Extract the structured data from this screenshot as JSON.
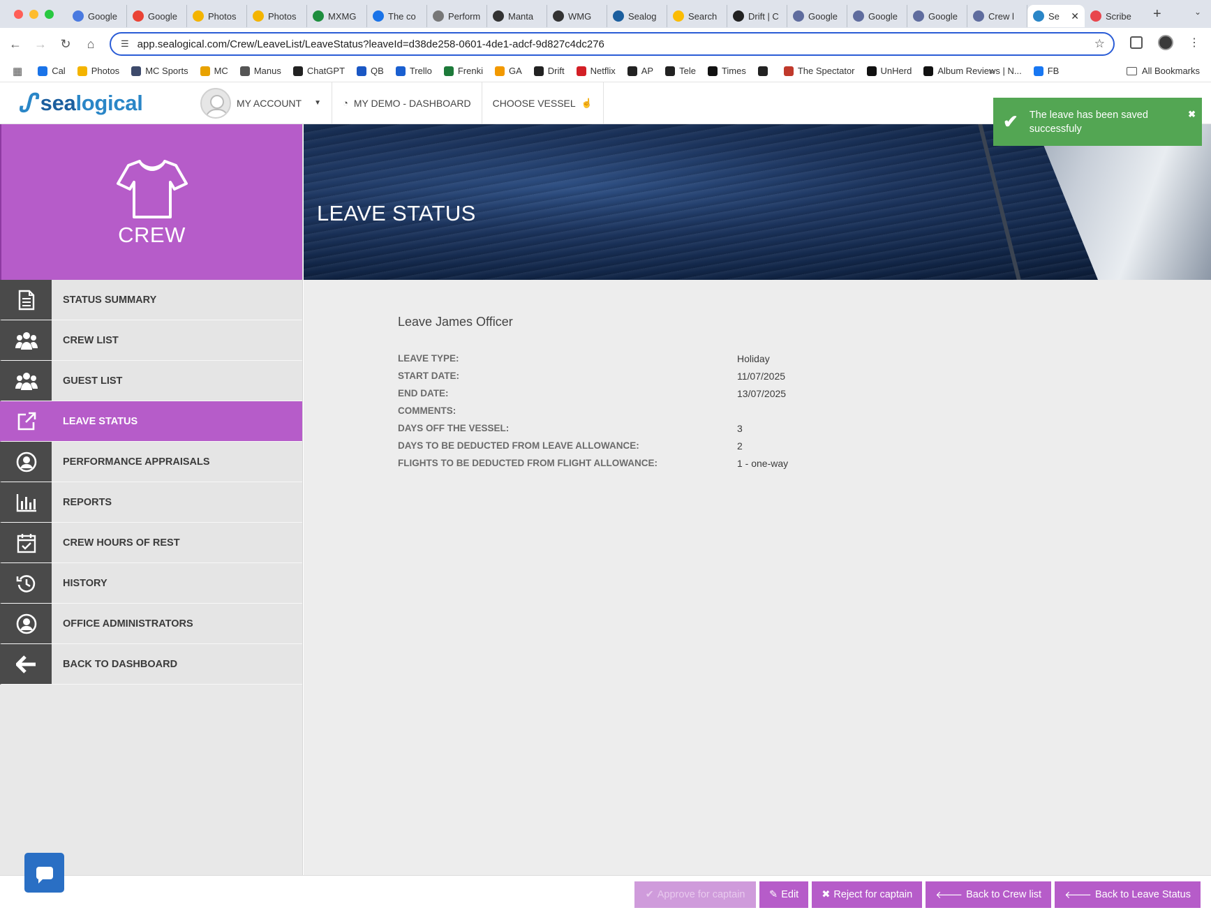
{
  "browser": {
    "tabs": [
      {
        "label": "Google",
        "color": "#4a7ae0"
      },
      {
        "label": "Google",
        "color": "#ea4335"
      },
      {
        "label": "Photos",
        "color": "#f4b400"
      },
      {
        "label": "Photos",
        "color": "#f4b400"
      },
      {
        "label": "MXMG",
        "color": "#1e8e3e"
      },
      {
        "label": "The co",
        "color": "#1a73e8"
      },
      {
        "label": "Perform",
        "color": "#777777"
      },
      {
        "label": "Manta",
        "color": "#333333"
      },
      {
        "label": "WMG",
        "color": "#333333"
      },
      {
        "label": "Sealog",
        "color": "#1b5e9e"
      },
      {
        "label": "Search",
        "color": "#fbbc04"
      },
      {
        "label": "Drift | C",
        "color": "#222222"
      },
      {
        "label": "Google",
        "color": "#5f6c9e"
      },
      {
        "label": "Google",
        "color": "#5f6c9e"
      },
      {
        "label": "Google",
        "color": "#5f6c9e"
      },
      {
        "label": "Crew l",
        "color": "#5f6c9e"
      }
    ],
    "active_tab": {
      "label": "Se",
      "color": "#2a86c7"
    },
    "after_tab": {
      "label": "Scribe",
      "color": "#e8464d"
    },
    "url": "app.sealogical.com/Crew/LeaveList/LeaveStatus?leaveId=d38de258-0601-4de1-adcf-9d827c4dc276",
    "bookmarks": [
      {
        "label": "Cal",
        "color": "#1a73e8"
      },
      {
        "label": "Photos",
        "color": "#f4b400"
      },
      {
        "label": "MC Sports",
        "color": "#3d4a6b"
      },
      {
        "label": "MC",
        "color": "#e8a200"
      },
      {
        "label": "Manus",
        "color": "#555555"
      },
      {
        "label": "ChatGPT",
        "color": "#222222"
      },
      {
        "label": "QB",
        "color": "#1a57c4"
      },
      {
        "label": "Trello",
        "color": "#1a5fd0"
      },
      {
        "label": "Frenki",
        "color": "#1d7a3a"
      },
      {
        "label": "GA",
        "color": "#f29900"
      },
      {
        "label": "Drift",
        "color": "#222222"
      },
      {
        "label": "Netflix",
        "color": "#d31f26"
      },
      {
        "label": "AP",
        "color": "#222222"
      },
      {
        "label": "Tele",
        "color": "#222222"
      },
      {
        "label": "Times",
        "color": "#111111"
      },
      {
        "label": "",
        "color": "#222222"
      },
      {
        "label": "The Spectator",
        "color": "#c0392b"
      },
      {
        "label": "UnHerd",
        "color": "#111111"
      },
      {
        "label": "Album Reviews | N...",
        "color": "#111111"
      },
      {
        "label": "FB",
        "color": "#1877f2"
      }
    ],
    "all_bookmarks": "All Bookmarks"
  },
  "header": {
    "logo": {
      "part1": "sea",
      "part2": "logical"
    },
    "account_label": "MY ACCOUNT",
    "dashboard_label": "MY DEMO - DASHBOARD",
    "vessel_label": "CHOOSE VESSEL"
  },
  "toast": {
    "message": "The leave has been saved successfuly",
    "close": "✖"
  },
  "sidebar": {
    "section_title": "CREW",
    "items": [
      {
        "label": "STATUS SUMMARY",
        "icon": "document-icon"
      },
      {
        "label": "CREW LIST",
        "icon": "users-icon"
      },
      {
        "label": "GUEST LIST",
        "icon": "users-icon"
      },
      {
        "label": "LEAVE STATUS",
        "icon": "external-link-icon",
        "active": true
      },
      {
        "label": "PERFORMANCE APPRAISALS",
        "icon": "user-circle-icon"
      },
      {
        "label": "REPORTS",
        "icon": "bar-chart-icon"
      },
      {
        "label": "CREW HOURS OF REST",
        "icon": "calendar-check-icon"
      },
      {
        "label": "HISTORY",
        "icon": "history-icon"
      },
      {
        "label": "OFFICE ADMINISTRATORS",
        "icon": "user-circle-icon"
      },
      {
        "label": "BACK TO DASHBOARD",
        "icon": "arrow-left-icon"
      }
    ],
    "active_color": "#b65cc9"
  },
  "main": {
    "page_title": "LEAVE STATUS",
    "heading": "Leave James Officer",
    "fields": [
      {
        "label": "LEAVE TYPE:",
        "value": "Holiday"
      },
      {
        "label": "START DATE:",
        "value": "11/07/2025"
      },
      {
        "label": "END DATE:",
        "value": "13/07/2025"
      },
      {
        "label": "COMMENTS:",
        "value": ""
      },
      {
        "label": "DAYS OFF THE VESSEL:",
        "value": "3"
      },
      {
        "label": "DAYS TO BE DEDUCTED FROM LEAVE ALLOWANCE:",
        "value": "2"
      },
      {
        "label": "FLIGHTS TO BE DEDUCTED FROM FLIGHT ALLOWANCE:",
        "value": "1 - one-way"
      }
    ]
  },
  "actions": {
    "approve": "Approve for captain",
    "edit": "Edit",
    "reject": "Reject for captain",
    "back_crew": "Back to Crew list",
    "back_leave": "Back to Leave Status"
  }
}
